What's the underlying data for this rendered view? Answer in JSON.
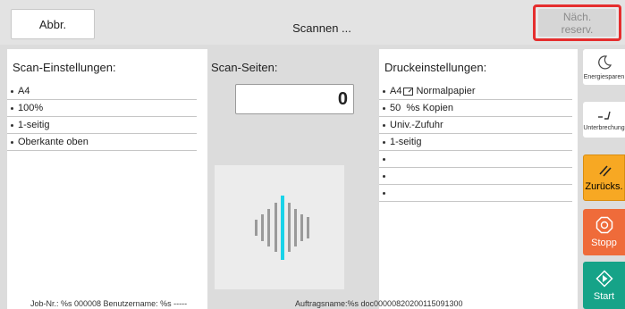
{
  "header": {
    "abbr_label": "Abbr.",
    "status_text": "Scannen ...",
    "next_reserve_line1": "Näch.",
    "next_reserve_line2": "reserv."
  },
  "scan_settings": {
    "title": "Scan-Einstellungen:",
    "items": [
      "A4",
      "100%",
      "1-seitig",
      "Oberkante oben"
    ]
  },
  "scan_pages": {
    "title": "Scan-Seiten:",
    "count": "0"
  },
  "print_settings": {
    "title": "Druckeinstellungen:",
    "items": [
      "A4",
      "50  %s Kopien",
      "Univ.-Zufuhr",
      "1-seitig",
      "",
      "",
      ""
    ],
    "paper_type": "Normalpapier"
  },
  "sidebar": {
    "energy_label": "Energiesparen",
    "interrupt_label": "Unterbrechung",
    "back_label": "Zurücks.",
    "stop_label": "Stopp",
    "start_label": "Start"
  },
  "footer": {
    "job_text": "Job-Nr.: %s 000008  Benutzername: %s  -----",
    "jobname_text": "Auftragsname:%s   doc00000820200115091300"
  },
  "colors": {
    "alert_border": "#e52e2e",
    "back_button": "#f7a823",
    "stop_button": "#ef6b3a",
    "start_button": "#16a388",
    "scan_active_bar": "#19d3e8"
  },
  "icons": [
    "moon-icon",
    "interrupt-icon",
    "reset-icon",
    "stop-icon",
    "start-icon",
    "paper-icon"
  ]
}
